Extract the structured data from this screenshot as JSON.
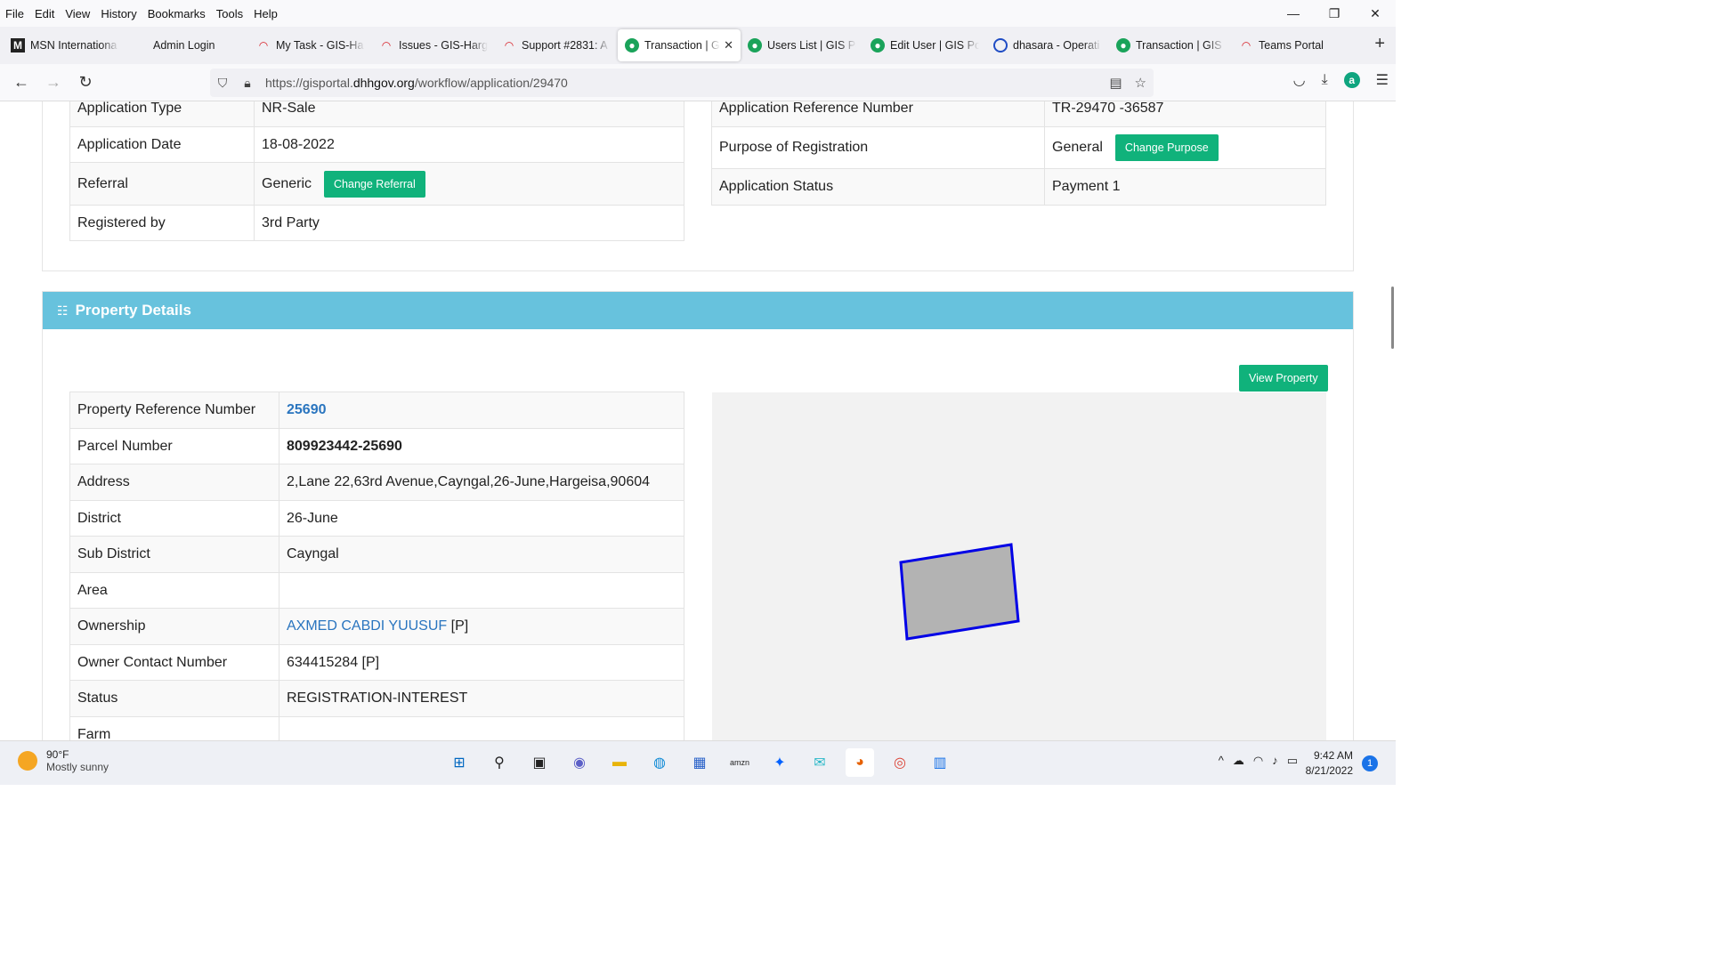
{
  "menu": [
    "File",
    "Edit",
    "View",
    "History",
    "Bookmarks",
    "Tools",
    "Help"
  ],
  "window_controls": {
    "minimize": "—",
    "restore": "❐",
    "close": "✕"
  },
  "tabs": [
    {
      "label": "MSN Internationa",
      "icon": "msn-icon"
    },
    {
      "label": "Admin Login",
      "icon": "none"
    },
    {
      "label": "My Task - GIS-Ha",
      "icon": "redmine-icon"
    },
    {
      "label": "Issues - GIS-Harg",
      "icon": "redmine-icon"
    },
    {
      "label": "Support #2831: A",
      "icon": "redmine-icon"
    },
    {
      "label": "Transaction | G",
      "icon": "gis-icon",
      "active": true
    },
    {
      "label": "Users List | GIS Po",
      "icon": "gis-icon"
    },
    {
      "label": "Edit User | GIS Po",
      "icon": "gis-icon"
    },
    {
      "label": "dhasara - Operati",
      "icon": "loader-icon"
    },
    {
      "label": "Transaction | GIS",
      "icon": "gis-icon"
    },
    {
      "label": "Teams Portal",
      "icon": "redmine-icon"
    }
  ],
  "url": {
    "prefix": "https://gisportal.",
    "domain": "dhhgov.org",
    "path": "/workflow/application/29470"
  },
  "app_info_left": [
    {
      "label": "Application Type",
      "value": "NR-Sale"
    },
    {
      "label": "Application Date",
      "value": "18-08-2022"
    },
    {
      "label": "Referral",
      "value": "Generic",
      "button": "Change Referral"
    },
    {
      "label": "Registered by",
      "value": "3rd Party"
    }
  ],
  "app_info_right": [
    {
      "label": "Application Reference Number",
      "value": "TR-29470 -36587"
    },
    {
      "label": "Purpose of Registration",
      "value": "General",
      "button": "Change Purpose"
    },
    {
      "label": "Application Status",
      "value": "Payment 1"
    }
  ],
  "property": {
    "title": "Property Details",
    "view_button": "View Property",
    "rows": [
      {
        "label": "Property Reference Number",
        "value": "25690",
        "style": "link-bold"
      },
      {
        "label": "Parcel Number",
        "value": "809923442-25690",
        "style": "bold"
      },
      {
        "label": "Address",
        "value": "2,Lane 22,63rd Avenue,Cayngal,26-June,Hargeisa,90604"
      },
      {
        "label": "District",
        "value": "26-June"
      },
      {
        "label": "Sub District",
        "value": "Cayngal"
      },
      {
        "label": "Area",
        "value": ""
      },
      {
        "label": "Ownership",
        "value": "AXMED CABDI YUUSUF",
        "suffix": " [P]",
        "style": "link"
      },
      {
        "label": "Owner Contact Number",
        "value": "634415284 [P]"
      },
      {
        "label": "Status",
        "value": "REGISTRATION-INTEREST"
      },
      {
        "label": "Farm",
        "value": ""
      }
    ]
  },
  "taskbar": {
    "weather_temp": "90°F",
    "weather_desc": "Mostly sunny",
    "time": "9:42 AM",
    "date": "8/21/2022",
    "notifications": "1"
  },
  "colors": {
    "accent_green": "#10b27b",
    "header_blue": "#67c2dd",
    "link_blue": "#2a75bf",
    "parcel_stroke": "#0000e6",
    "parcel_fill": "#b3b3b3"
  }
}
